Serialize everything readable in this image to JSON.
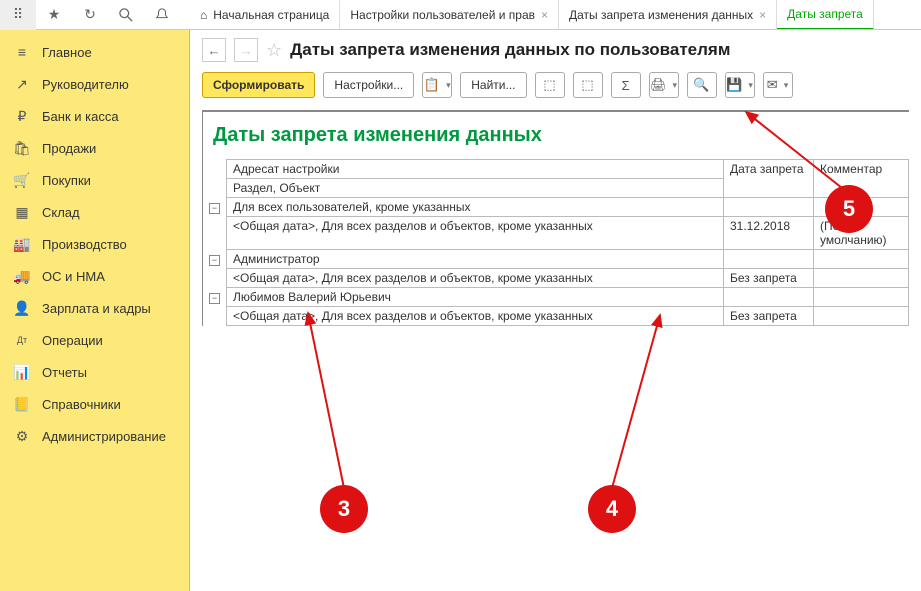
{
  "topbar": {
    "tabs": [
      {
        "label": "Начальная страница",
        "closable": false,
        "active": false,
        "icon": "home"
      },
      {
        "label": "Настройки пользователей и прав",
        "closable": true,
        "active": false
      },
      {
        "label": "Даты запрета изменения данных",
        "closable": true,
        "active": false
      },
      {
        "label": "Даты запрета",
        "closable": false,
        "active": true
      }
    ]
  },
  "sidebar": {
    "items": [
      {
        "label": "Главное",
        "icon": "≡"
      },
      {
        "label": "Руководителю",
        "icon": "↗"
      },
      {
        "label": "Банк и касса",
        "icon": "₽"
      },
      {
        "label": "Продажи",
        "icon": "🛍"
      },
      {
        "label": "Покупки",
        "icon": "🛒"
      },
      {
        "label": "Склад",
        "icon": "▦"
      },
      {
        "label": "Производство",
        "icon": "🏭"
      },
      {
        "label": "ОС и НМА",
        "icon": "🚚"
      },
      {
        "label": "Зарплата и кадры",
        "icon": "👤"
      },
      {
        "label": "Операции",
        "icon": "Дт"
      },
      {
        "label": "Отчеты",
        "icon": "📊"
      },
      {
        "label": "Справочники",
        "icon": "📒"
      },
      {
        "label": "Администрирование",
        "icon": "⚙"
      }
    ]
  },
  "page": {
    "title": "Даты запрета изменения данных по пользователям",
    "report_title": "Даты запрета изменения данных"
  },
  "toolbar": {
    "generate": "Сформировать",
    "settings": "Настройки...",
    "find": "Найти..."
  },
  "report": {
    "columns": {
      "c1a": "Адресат настройки",
      "c1b": "Раздел, Объект",
      "c2": "Дата запрета",
      "c3": "Комментар"
    },
    "rows": [
      {
        "type": "group",
        "label": "Для всех пользователей, кроме указанных"
      },
      {
        "type": "item",
        "label": "<Общая дата>, Для всех разделов и объектов, кроме указанных",
        "date": "31.12.2018",
        "comment": "(По умолчанию)"
      },
      {
        "type": "group",
        "label": "Администратор"
      },
      {
        "type": "item",
        "label": "<Общая дата>, Для всех разделов и объектов, кроме указанных",
        "date": "Без запрета",
        "comment": ""
      },
      {
        "type": "group",
        "label": "Любимов Валерий Юрьевич"
      },
      {
        "type": "item",
        "label": "<Общая дата>, Для всех разделов и объектов, кроме указанных",
        "date": "Без запрета",
        "comment": ""
      }
    ]
  },
  "markers": {
    "m3": "3",
    "m4": "4",
    "m5": "5"
  }
}
